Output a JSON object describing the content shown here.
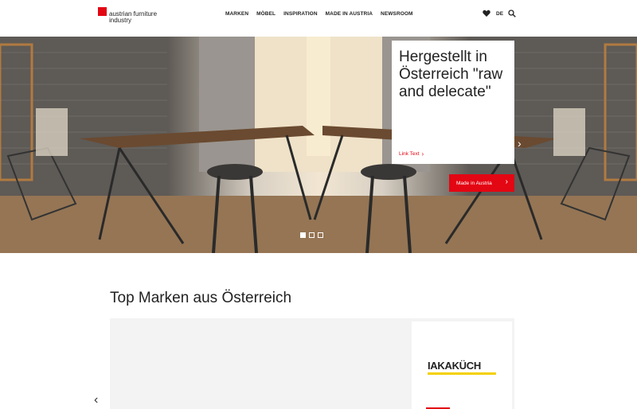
{
  "header": {
    "logo_text": "austrian furniture industry",
    "nav": [
      "MARKEN",
      "MÖBEL",
      "INSPIRATION",
      "MADE IN AUSTRIA",
      "NEWSROOM"
    ],
    "lang": "DE"
  },
  "hero": {
    "title": "Hergestellt in Österreich \"raw and delecate\"",
    "link_text": "Link Text",
    "button_label": "Made in Austria",
    "slides_total": 3,
    "active_slide": 1
  },
  "section": {
    "title": "Top Marken aus Österreich",
    "brand_logo_left": "IAKA",
    "brand_logo_right": "KÜCH"
  },
  "colors": {
    "accent": "#e30613",
    "brand_yellow": "#f3d000"
  }
}
